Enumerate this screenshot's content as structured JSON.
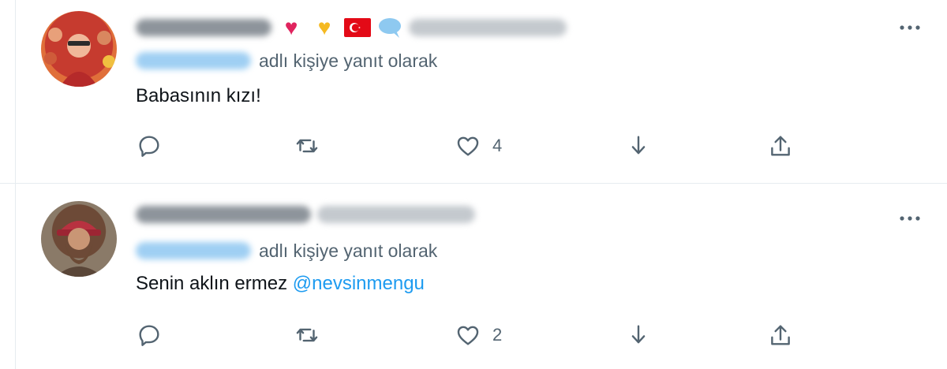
{
  "tweets": [
    {
      "reply_prefix": "adlı kişiye yanıt olarak",
      "text": "Babasının kızı!",
      "mention": "",
      "like_count": "4",
      "header_emojis": [
        "heart-red",
        "heart-yellow",
        "turkish-flag",
        "speech-bubble"
      ]
    },
    {
      "reply_prefix": "adlı kişiye yanıt olarak",
      "text": "Senin aklın ermez",
      "mention": "@nevsinmengu",
      "like_count": "2",
      "header_emojis": []
    }
  ],
  "colors": {
    "text": "#0f1419",
    "secondary": "#536471",
    "link": "#1d9bf0",
    "divider": "#e6ecf0"
  },
  "icons": [
    "more-icon",
    "reply-icon",
    "retweet-icon",
    "like-icon",
    "share-icon",
    "upload-icon"
  ]
}
